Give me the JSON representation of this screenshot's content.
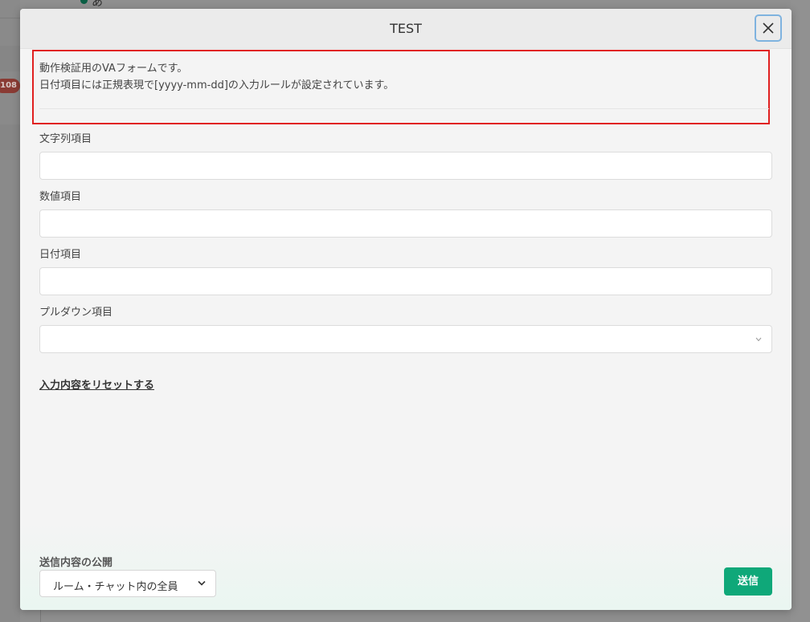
{
  "background": {
    "badge_count": "108",
    "avatar_text": "あ"
  },
  "modal": {
    "title": "TEST",
    "description_lines": [
      "動作検証用のVAフォームです。",
      "日付項目には正規表現で[yyyy-mm-dd]の入力ルールが設定されています。"
    ],
    "fields": [
      {
        "label": "文字列項目",
        "value": "",
        "placeholder": ""
      },
      {
        "label": "数値項目",
        "value": "",
        "placeholder": ""
      },
      {
        "label": "日付項目",
        "value": "",
        "placeholder": ""
      },
      {
        "label": "プルダウン項目",
        "value": ""
      }
    ],
    "reset_label": "入力内容をリセットする",
    "publish_label": "送信内容の公開",
    "publish_value": "ルーム・チャット内の全員",
    "submit_label": "送信"
  },
  "colors": {
    "accent": "#0fa879",
    "highlight_border": "#e02020",
    "focus_ring": "#7fb3df"
  },
  "icons": [
    "close-icon",
    "chevron-down-icon"
  ]
}
